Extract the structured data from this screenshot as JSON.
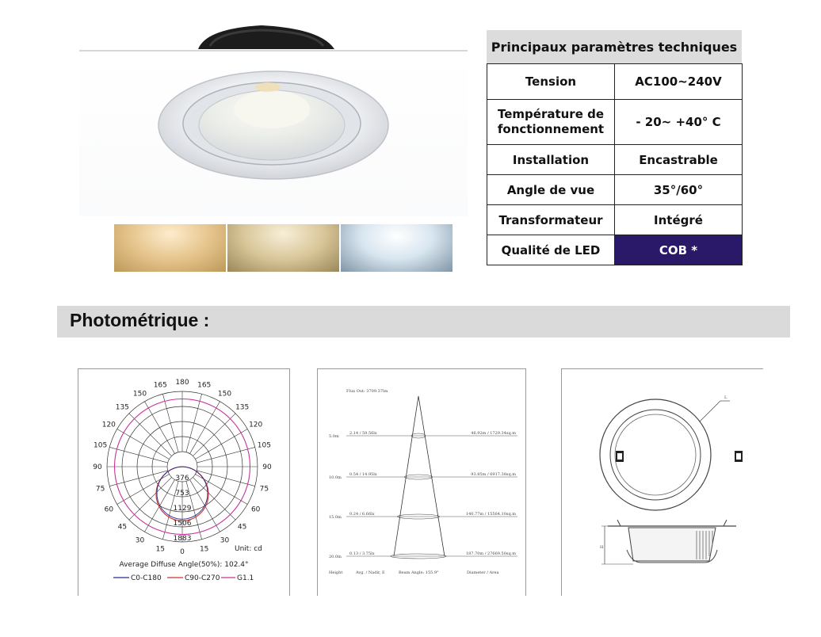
{
  "spec": {
    "title": "Principaux paramètres techniques",
    "rows": [
      {
        "label": "Tension",
        "value": "AC100~240V"
      },
      {
        "label": "Température de fonctionnement",
        "value": "- 20~ +40° C"
      },
      {
        "label": "Installation",
        "value": "Encastrable"
      },
      {
        "label": "Angle de vue",
        "value": "35°/60°"
      },
      {
        "label": "Transformateur",
        "value": "Intégré"
      },
      {
        "label": "Qualité de LED",
        "value": "COB *"
      }
    ],
    "highlight_color": "#2a1868"
  },
  "section": {
    "title": "Photométrique :"
  },
  "polar": {
    "angles_left": [
      "165",
      "150",
      "135",
      "120",
      "105",
      "90",
      "75",
      "60",
      "45",
      "30",
      "15"
    ],
    "angles_right": [
      "165",
      "150",
      "135",
      "120",
      "105",
      "90",
      "75",
      "60",
      "45",
      "30",
      "15"
    ],
    "top_angle": "180",
    "bottom_angle": "0",
    "radial_values": [
      "376",
      "753",
      "1129",
      "1506",
      "1883"
    ],
    "unit": "Unit: cd",
    "average_angle": "Average Diffuse Angle(50%): 102.4°",
    "legend": [
      {
        "name": "C0-C180",
        "color": "#2a2a8a"
      },
      {
        "name": "C90-C270",
        "color": "#d03030"
      },
      {
        "name": "G1.1",
        "color": "#c8309a"
      }
    ]
  },
  "cone": {
    "flux": "Flux Out: 3709.37lm",
    "rows": [
      {
        "height": "5.0m",
        "avg": "2.14 / 59.56lx",
        "diameter": "46.92m / 1729.34sq.m"
      },
      {
        "height": "10.0m",
        "avg": "0.54 / 14.95lx",
        "diameter": "93.85m / 6917.38sq.m"
      },
      {
        "height": "15.0m",
        "avg": "0.24 / 6.66lx",
        "diameter": "140.77m / 15564.10sq.m"
      },
      {
        "height": "20.0m",
        "avg": "0.13 / 3.75lx",
        "diameter": "187.70m / 27669.50sq.m"
      }
    ],
    "footer": {
      "height": "Height",
      "avg": "Avg. / Nadir, E",
      "beam": "Beam Angle: 155.9°",
      "diameter": "Diameter / Area"
    }
  },
  "drawing": {
    "label_l": "L",
    "label_h": "H"
  }
}
